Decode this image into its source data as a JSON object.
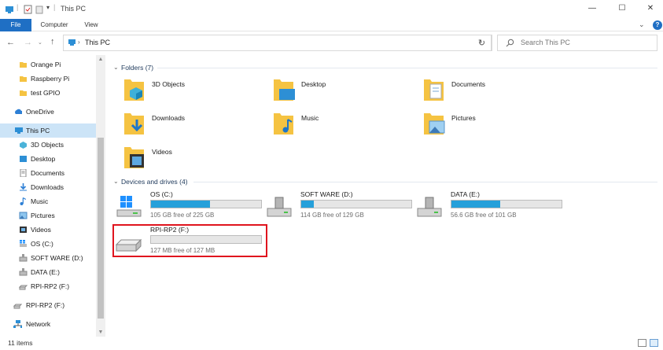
{
  "window": {
    "title": "This PC",
    "controls": {
      "minimize": "—",
      "maximize": "☐",
      "close": "✕"
    }
  },
  "ribbon": {
    "tabs": [
      "File",
      "Computer",
      "View"
    ],
    "help": "?"
  },
  "address_bar": {
    "location": "This PC",
    "search_placeholder": "Search This PC"
  },
  "sidebar": {
    "items": [
      {
        "label": "Orange Pi",
        "icon": "folder-icon"
      },
      {
        "label": "Raspberry Pi",
        "icon": "folder-icon"
      },
      {
        "label": "test GPIO",
        "icon": "folder-icon"
      },
      {
        "label": "OneDrive",
        "icon": "cloud-icon"
      },
      {
        "label": "This PC",
        "icon": "computer-icon",
        "selected": true
      },
      {
        "label": "3D Objects",
        "icon": "3d-objects-icon"
      },
      {
        "label": "Desktop",
        "icon": "desktop-icon"
      },
      {
        "label": "Documents",
        "icon": "documents-icon"
      },
      {
        "label": "Downloads",
        "icon": "downloads-icon"
      },
      {
        "label": "Music",
        "icon": "music-icon"
      },
      {
        "label": "Pictures",
        "icon": "pictures-icon"
      },
      {
        "label": "Videos",
        "icon": "videos-icon"
      },
      {
        "label": "OS (C:)",
        "icon": "windows-drive-icon"
      },
      {
        "label": "SOFT WARE (D:)",
        "icon": "drive-icon"
      },
      {
        "label": "DATA (E:)",
        "icon": "drive-icon"
      },
      {
        "label": "RPI-RP2 (F:)",
        "icon": "usb-drive-icon"
      },
      {
        "label": "RPI-RP2 (F:)",
        "icon": "usb-drive-icon"
      },
      {
        "label": "Network",
        "icon": "network-icon"
      }
    ]
  },
  "folders": {
    "header": "Folders (7)",
    "items": [
      {
        "label": "3D Objects",
        "icon": "3d-objects-folder-icon"
      },
      {
        "label": "Desktop",
        "icon": "desktop-folder-icon"
      },
      {
        "label": "Documents",
        "icon": "documents-folder-icon"
      },
      {
        "label": "Downloads",
        "icon": "downloads-folder-icon"
      },
      {
        "label": "Music",
        "icon": "music-folder-icon"
      },
      {
        "label": "Pictures",
        "icon": "pictures-folder-icon"
      },
      {
        "label": "Videos",
        "icon": "videos-folder-icon"
      }
    ]
  },
  "drives": {
    "header": "Devices and drives (4)",
    "items": [
      {
        "name": "OS (C:)",
        "free_text": "105 GB free of 225 GB",
        "used_fraction": 0.533,
        "icon": "windows-drive-icon"
      },
      {
        "name": "SOFT WARE (D:)",
        "free_text": "114 GB free of 129 GB",
        "used_fraction": 0.116,
        "icon": "hard-drive-icon"
      },
      {
        "name": "DATA (E:)",
        "free_text": "56.6 GB free of 101 GB",
        "used_fraction": 0.44,
        "icon": "hard-drive-icon"
      },
      {
        "name": "RPI-RP2 (F:)",
        "free_text": "127 MB free of 127 MB",
        "used_fraction": 0.0,
        "icon": "usb-drive-icon",
        "highlighted": true
      }
    ]
  },
  "colors": {
    "accent": "#1f6fc4",
    "selection": "#cce4f7",
    "drive_fill": "#26a0da",
    "highlight": "#e0141e",
    "folder_yellow": "#f5c342"
  },
  "status": {
    "item_count": "11 items"
  }
}
